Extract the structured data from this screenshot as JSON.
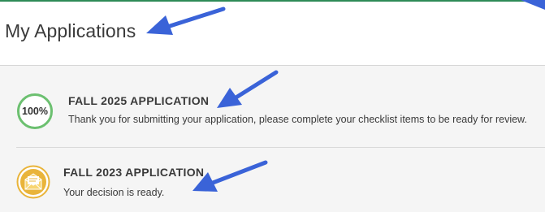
{
  "header": {
    "title": "My Applications"
  },
  "applications": [
    {
      "title": "FALL 2025 APPLICATION",
      "message": "Thank you for submitting your application, please complete your checklist items to be ready for review.",
      "progress_label": "100%",
      "progress_value": 1.0,
      "icon": "progress-ring-icon"
    },
    {
      "title": "FALL 2023 APPLICATION",
      "message": "Your decision is ready.",
      "icon": "envelope-icon"
    }
  ],
  "colors": {
    "top_accent": "#2e8b57",
    "progress_ring": "#6cc070",
    "envelope_badge": "#e9b43a",
    "annotation_arrow": "#3a63d8",
    "list_background": "#f5f5f5"
  }
}
